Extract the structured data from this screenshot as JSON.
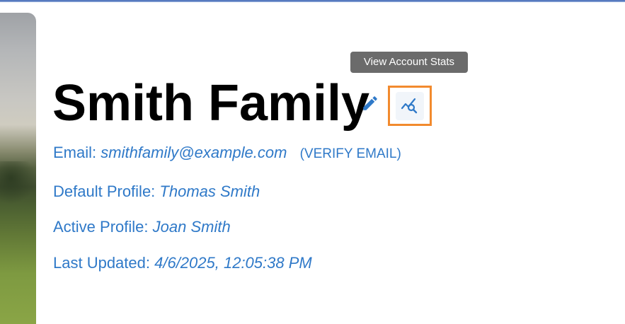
{
  "tooltip": "View Account Stats",
  "title": "Smith Family",
  "icons": {
    "edit": "pencil-icon",
    "stats": "chart-search-icon"
  },
  "email": {
    "label": "Email:",
    "value": "smithfamily@example.com",
    "verify_link": "(VERIFY EMAIL)"
  },
  "default_profile": {
    "label": "Default Profile:",
    "value": "Thomas Smith"
  },
  "active_profile": {
    "label": "Active Profile:",
    "value": "Joan Smith"
  },
  "last_updated": {
    "label": "Last Updated:",
    "value": "4/6/2025, 12:05:38 PM"
  },
  "colors": {
    "link": "#2f79c8",
    "highlight": "#f28a2e",
    "tooltip_bg": "#6b6b6b"
  }
}
